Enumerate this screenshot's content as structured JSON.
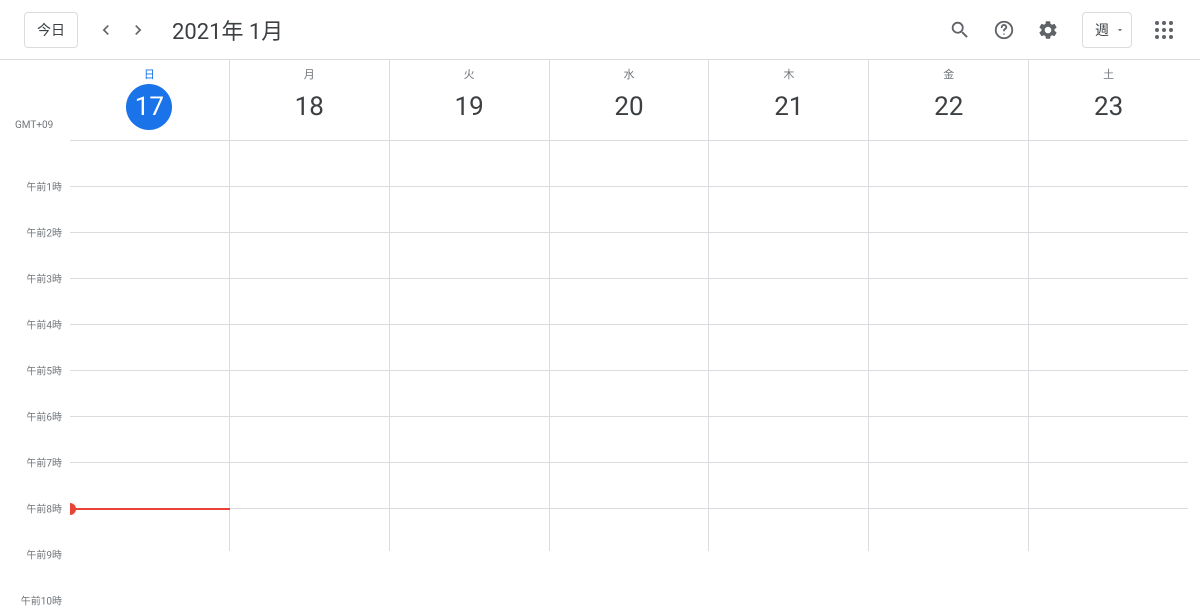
{
  "header": {
    "today_label": "今日",
    "month_label": "2021年 1月",
    "view_label": "週"
  },
  "timezone": "GMT+09",
  "days": [
    {
      "dow": "日",
      "num": "17",
      "today": true
    },
    {
      "dow": "月",
      "num": "18",
      "today": false
    },
    {
      "dow": "火",
      "num": "19",
      "today": false
    },
    {
      "dow": "水",
      "num": "20",
      "today": false
    },
    {
      "dow": "木",
      "num": "21",
      "today": false
    },
    {
      "dow": "金",
      "num": "22",
      "today": false
    },
    {
      "dow": "土",
      "num": "23",
      "today": false
    }
  ],
  "hours": [
    "午前1時",
    "午前2時",
    "午前3時",
    "午前4時",
    "午前5時",
    "午前6時",
    "午前7時",
    "午前8時",
    "午前9時",
    "午前10時"
  ],
  "now": {
    "day_index": 0,
    "hour_fraction": 8.0
  }
}
